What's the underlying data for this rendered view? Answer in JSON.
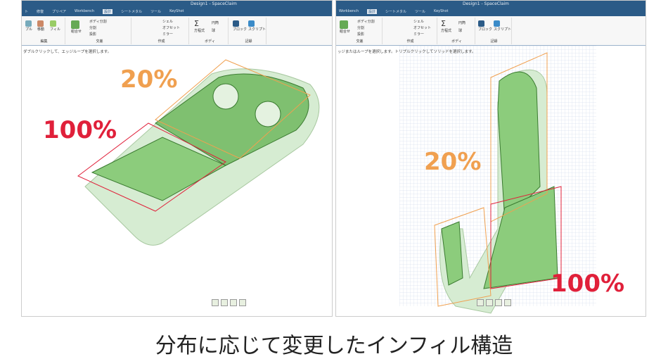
{
  "left_window": {
    "title": "Design1 - SpaceClaim",
    "tabs": [
      "ト",
      "修復",
      "プリペア",
      "Workbench",
      "設計",
      "シートメタル",
      "ツール",
      "KeyShot"
    ],
    "active_tab": "設計",
    "ribbon": {
      "edit": {
        "label": "編集",
        "items": [
          "プル",
          "移動",
          "フィル"
        ]
      },
      "intersect": {
        "label": "交差",
        "items": [
          "組合せ",
          "ボディ分割",
          "分割",
          "投影"
        ]
      },
      "create": {
        "label": "作成",
        "items": [
          "シェル",
          "オフセット",
          "ミラー"
        ]
      },
      "body": {
        "label": "ボディ",
        "items": [
          "方程式",
          "円筒",
          "球"
        ]
      },
      "record": {
        "label": "記録",
        "items": [
          "ブロック",
          "スクリプト"
        ]
      }
    },
    "status": "ダブルクリックして、エッジループを選択します。",
    "labels": {
      "top": "20%",
      "bottom": "100%"
    }
  },
  "right_window": {
    "title": "Design1 - SpaceClaim",
    "tabs": [
      "Workbench",
      "設計",
      "シートメタル",
      "ツール",
      "KeyShot"
    ],
    "active_tab": "設計",
    "ribbon": {
      "intersect": {
        "label": "交差",
        "items": [
          "組合せ",
          "ボディ分割",
          "分割",
          "投影"
        ]
      },
      "create": {
        "label": "作成",
        "items": [
          "シェル",
          "オフセット",
          "ミラー"
        ]
      },
      "body": {
        "label": "ボディ",
        "items": [
          "方程式",
          "円筒",
          "球"
        ]
      },
      "record": {
        "label": "記録",
        "items": [
          "ブロック",
          "スクリプト"
        ]
      }
    },
    "status": "ッジまたはループを選択します。トリプルクリックしてソリッドを選択します。",
    "labels": {
      "top": "20%",
      "bottom": "100%"
    }
  },
  "caption": "分布に応じて変更したインフィル構造",
  "colors": {
    "title_bar": "#2b5b87",
    "label_20": "#f0a050",
    "label_100": "#e0203a",
    "model_fill": "#cfe8c8",
    "infill_green": "#6cb85c"
  }
}
